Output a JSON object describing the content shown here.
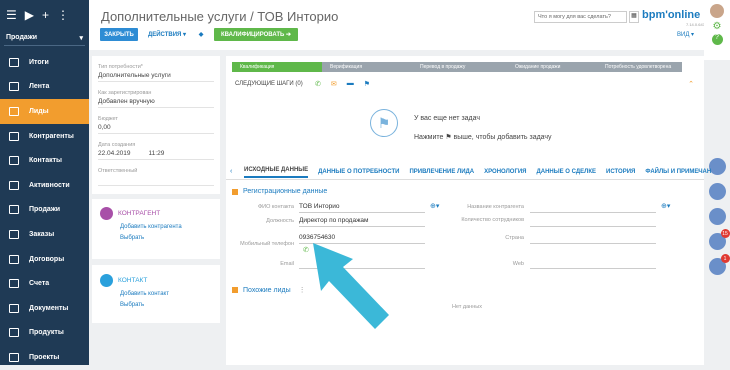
{
  "sidebar": {
    "section": "Продажи",
    "items": [
      {
        "label": "Итоги",
        "icon": "dashboard-icon"
      },
      {
        "label": "Лента",
        "icon": "feed-icon"
      },
      {
        "label": "Лиды",
        "icon": "leads-icon",
        "active": true
      },
      {
        "label": "Контрагенты",
        "icon": "accounts-icon"
      },
      {
        "label": "Контакты",
        "icon": "contacts-icon"
      },
      {
        "label": "Активности",
        "icon": "activities-icon"
      },
      {
        "label": "Продажи",
        "icon": "opportunities-icon"
      },
      {
        "label": "Заказы",
        "icon": "orders-icon"
      },
      {
        "label": "Договоры",
        "icon": "contracts-icon"
      },
      {
        "label": "Счета",
        "icon": "invoices-icon"
      },
      {
        "label": "Документы",
        "icon": "documents-icon"
      },
      {
        "label": "Продукты",
        "icon": "products-icon"
      },
      {
        "label": "Проекты",
        "icon": "projects-icon"
      }
    ]
  },
  "header": {
    "title": "Дополнительные услуги / ТОВ Инторио",
    "close": "ЗАКРЫТЬ",
    "actions": "ДЕЙСТВИЯ",
    "qualify": "КВАЛИФИЦИРОВАТЬ",
    "search_placeholder": "Что я могу для вас сделать?",
    "logo": "bpm'online",
    "version": "7.14.0.647",
    "view": "ВИД"
  },
  "info": {
    "need_type_label": "Тип потребности*",
    "need_type": "Дополнительные услуги",
    "registered_label": "Как зарегистрирован",
    "registered": "Добавлен вручную",
    "budget_label": "Бюджет",
    "budget": "0,00",
    "created_label": "Дата создания",
    "created_date": "22.04.2019",
    "created_time": "11:29",
    "owner_label": "Ответственный"
  },
  "account": {
    "title": "КОНТРАГЕНТ",
    "add": "Добавить контрагента",
    "select": "Выбрать"
  },
  "contact": {
    "title": "КОНТАКТ",
    "add": "Добавить контакт",
    "select": "Выбрать"
  },
  "stages": [
    "Квалификация",
    "Верификация",
    "Перевод в продажу",
    "Ожидание продажи",
    "Потребность удовлетворена"
  ],
  "next_steps": "СЛЕДУЮЩИЕ ШАГИ (0)",
  "tasks": {
    "empty": "У вас еще нет задач",
    "hint": "Нажмите ⚑ выше, чтобы добавить задачу"
  },
  "tabs": [
    "ИСХОДНЫЕ ДАННЫЕ",
    "ДАННЫЕ О ПОТРЕБНОСТИ",
    "ПРИВЛЕЧЕНИЕ ЛИДА",
    "ХРОНОЛОГИЯ",
    "ДАННЫЕ О СДЕЛКЕ",
    "ИСТОРИЯ",
    "ФАЙЛЫ И ПРИМЕЧАН"
  ],
  "reg": {
    "title": "Регистрационные данные",
    "fio_label": "ФИО контакта",
    "fio": "ТОВ Инторио",
    "position_label": "Должность",
    "position": "Директор по продажам",
    "mobile_label": "Мобильный телефон",
    "mobile": "0936754630",
    "email_label": "Email",
    "account_name_label": "Название контрагента",
    "employees_label": "Количество сотрудников",
    "country_label": "Страна",
    "web_label": "Web"
  },
  "similar": {
    "title": "Похожие лиды",
    "empty": "Нет данных"
  },
  "colors": {
    "sidebar": "#1f3a55",
    "accent": "#f29d2e",
    "blue": "#1b7bbf",
    "green": "#5fb84a",
    "arrow": "#3bb8d8"
  }
}
